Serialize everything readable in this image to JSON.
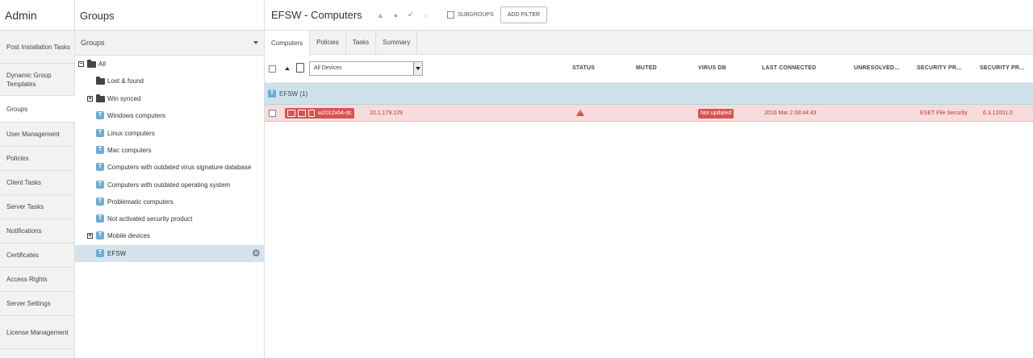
{
  "admin": {
    "title": "Admin",
    "items": [
      {
        "label": "Post Installation Tasks"
      },
      {
        "label": "Dynamic Group Templates"
      },
      {
        "label": "Groups"
      },
      {
        "label": "User Management"
      },
      {
        "label": "Policies"
      },
      {
        "label": "Client Tasks"
      },
      {
        "label": "Server Tasks"
      },
      {
        "label": "Notifications"
      },
      {
        "label": "Certificates"
      },
      {
        "label": "Access Rights"
      },
      {
        "label": "Server Settings"
      },
      {
        "label": "License Management"
      }
    ],
    "active": "Groups"
  },
  "groups_panel": {
    "title": "Groups",
    "header": "Groups",
    "tree": [
      {
        "label": "All",
        "kind": "folder",
        "expander": "−"
      },
      {
        "label": "Lost & found",
        "kind": "folder"
      },
      {
        "label": "Win synced",
        "kind": "folder",
        "expander": "+"
      },
      {
        "label": "Windows computers",
        "kind": "dynamic"
      },
      {
        "label": "Linux computers",
        "kind": "dynamic"
      },
      {
        "label": "Mac computers",
        "kind": "dynamic"
      },
      {
        "label": "Computers with outdated virus signature database",
        "kind": "dynamic"
      },
      {
        "label": "Computers with outdated operating system",
        "kind": "dynamic"
      },
      {
        "label": "Problematic computers",
        "kind": "dynamic"
      },
      {
        "label": "Not activated security product",
        "kind": "dynamic"
      },
      {
        "label": "Mobile devices",
        "kind": "dynamic",
        "expander": "+"
      },
      {
        "label": "EFSW",
        "kind": "dynamic",
        "selected": true
      }
    ]
  },
  "main": {
    "title": "EFSW - Computers",
    "subgroups_label": "SUBGROUPS",
    "add_filter_label": "ADD FILTER",
    "tabs": [
      {
        "label": "Computers"
      },
      {
        "label": "Policies"
      },
      {
        "label": "Tasks"
      },
      {
        "label": "Summary"
      }
    ],
    "device_filter": "All Devices",
    "columns": {
      "status": "STATUS",
      "muted": "MUTED",
      "virus_db": "VIRUS DB",
      "last_connected": "LAST CONNECTED",
      "unresolved": "UNRESOLVED...",
      "security_product": "SECURITY PR...",
      "security_version": "SECURITY PR..."
    },
    "group_row": "EFSW (1)",
    "rows": [
      {
        "name": "w2012x64-dc",
        "ip": "10.1.179.129",
        "status_icon": "warning-icon",
        "virus_db": "Not updated",
        "last_connected": "2016 Mar 2 08:44:43",
        "security_product": "ESET File Security",
        "security_version": "6.3.12001.0"
      }
    ]
  },
  "colors": {
    "selected_row": "#d5e4ec",
    "alert_row": "#f6dcdc",
    "alert": "#d9534f",
    "group_row": "#cfe2ea"
  }
}
